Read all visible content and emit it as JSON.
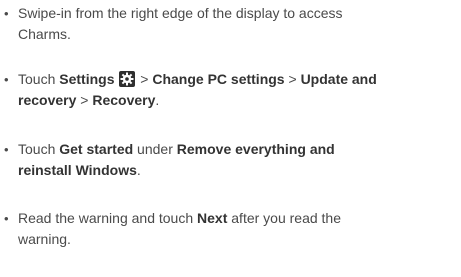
{
  "steps": [
    {
      "bullet": "•",
      "line1": "Swipe-in from the right edge of the display to access",
      "line2": "Charms."
    },
    {
      "bullet": "•",
      "pre": "Touch ",
      "settings": "Settings",
      "icon": "gear-icon",
      "sep1": " > ",
      "change": "Change PC settings",
      "sep2": " > ",
      "update": "Update and",
      "recovery1": "recovery",
      "sep3": " > ",
      "recovery2": "Recovery",
      "end": "."
    },
    {
      "bullet": "•",
      "pre": "Touch ",
      "getstarted": "Get started",
      "under": " under ",
      "remove": "Remove everything and",
      "reinstall": "reinstall Windows",
      "end": "."
    },
    {
      "bullet": "•",
      "pre": "Read the warning and touch ",
      "next": "Next",
      "post": " after you read the",
      "line2": "warning."
    }
  ]
}
